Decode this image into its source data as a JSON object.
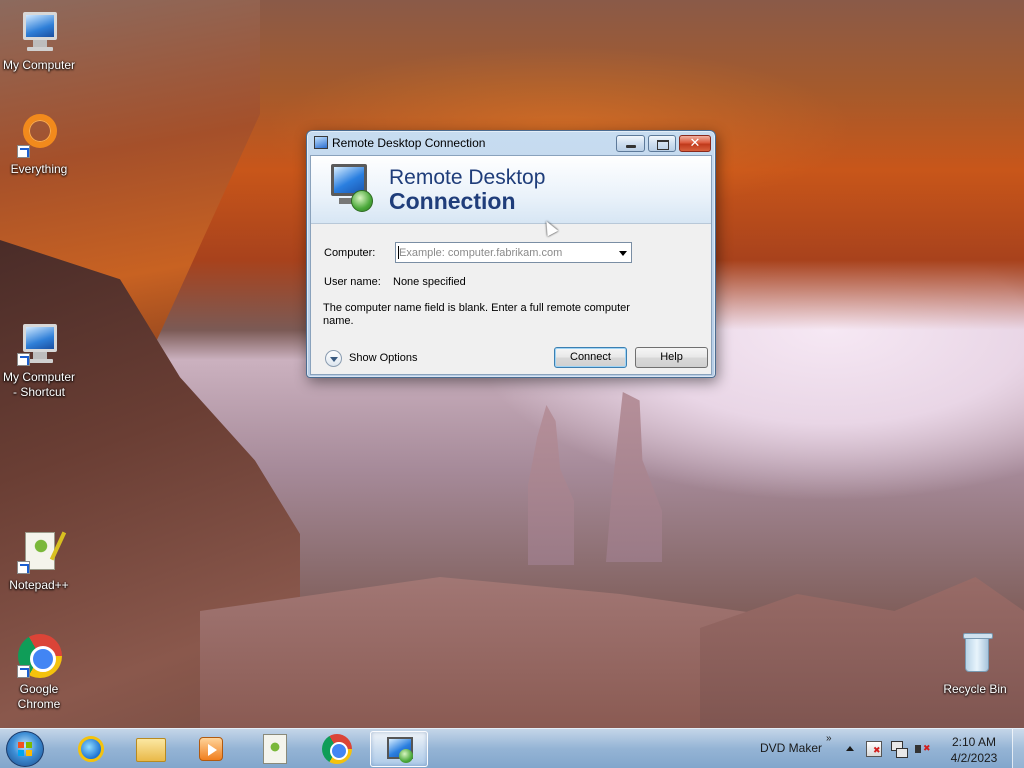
{
  "desktop": {
    "icons": [
      {
        "label": "My Computer",
        "icon": "computer-icon"
      },
      {
        "label": "Everything",
        "icon": "everything-ring-icon"
      },
      {
        "label": "My Computer - Shortcut",
        "icon": "computer-icon"
      },
      {
        "label": "Notepad++",
        "icon": "notepad-plus-plus-icon"
      },
      {
        "label": "Google Chrome",
        "icon": "chrome-icon"
      },
      {
        "label": "Recycle Bin",
        "icon": "recycle-bin-icon"
      }
    ]
  },
  "window": {
    "title": "Remote Desktop Connection",
    "banner": {
      "line1": "Remote Desktop",
      "line2": "Connection"
    },
    "computer_label": "Computer:",
    "computer_placeholder": "Example: computer.fabrikam.com",
    "username_label": "User name:",
    "username_value": "None specified",
    "message": "The computer name field is blank. Enter a full remote computer name.",
    "show_options": "Show Options",
    "connect_label": "Connect",
    "help_label": "Help",
    "close_glyph": "✕"
  },
  "taskbar": {
    "pinned": [
      {
        "name": "internet-explorer",
        "icon": "ie-icon"
      },
      {
        "name": "file-explorer",
        "icon": "folder-icon"
      },
      {
        "name": "media-player",
        "icon": "media-player-icon"
      },
      {
        "name": "notepad-plus-plus",
        "icon": "notepad-plus-plus-icon"
      },
      {
        "name": "google-chrome",
        "icon": "chrome-icon"
      },
      {
        "name": "remote-desktop",
        "icon": "remote-desktop-icon",
        "active": true
      }
    ],
    "toolbar_label": "DVD Maker",
    "toolbar_chevron": "»",
    "clock": {
      "time": "2:10 AM",
      "date": "4/2/2023"
    }
  },
  "colors": {
    "title_text": "#000000",
    "banner_text": "#1f3d7a",
    "close_button": "#c8452a"
  }
}
